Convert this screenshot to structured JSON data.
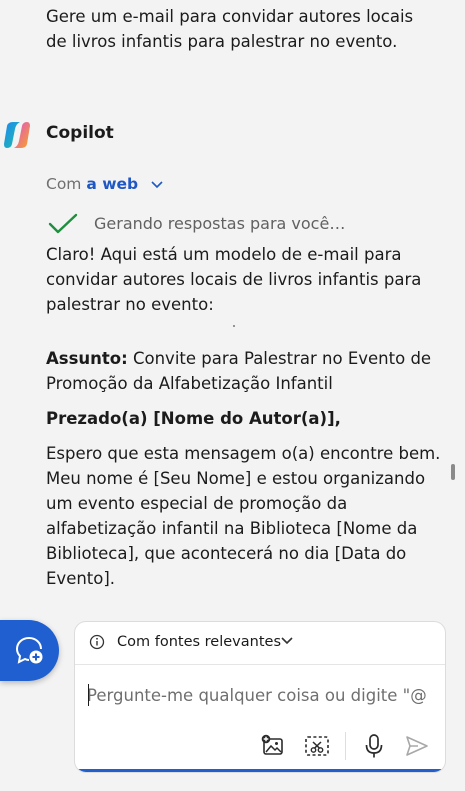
{
  "user_prompt": "Gere um e-mail para convidar autores locais de livros infantis para palestrar no evento.",
  "assistant": {
    "name": "Copilot",
    "source_prefix": "Com",
    "source_value": "a web",
    "status_text": "Gerando respostas para você…",
    "intro": "Claro! Aqui está um modelo de e-mail para convidar autores locais de livros infantis para palestrar no evento:",
    "subject_label": "Assunto:",
    "subject_text": " Convite para Palestrar no Evento de Promoção da Alfabetização Infantil",
    "greeting": "Prezado(a) [Nome do Autor(a)],",
    "paragraph": "Espero que esta mensagem o(a) encontre bem. Meu nome é [Seu Nome] e estou organizando um evento especial de promoção da alfabetização infantil na Biblioteca [Nome da Biblioteca], que acontecerá no dia [Data do Evento]."
  },
  "composer": {
    "filter_label": "Com fontes relevantes",
    "placeholder": "Pergunte-me qualquer coisa ou digite \"@\""
  },
  "colors": {
    "accent": "#1f5fd0",
    "link": "#1f57c3",
    "check": "#1e8f3e",
    "background": "#f3f3f3"
  },
  "icons": {
    "logo": "copilot-logo",
    "source_toggle": "chevron-down-icon",
    "status": "checkmark-icon",
    "new_topic": "new-topic-icon",
    "filter_info": "info-icon",
    "filter_toggle": "chevron-down-icon",
    "add_image": "add-image-icon",
    "screenshot": "screenshot-icon",
    "mic": "microphone-icon",
    "send": "send-icon"
  }
}
